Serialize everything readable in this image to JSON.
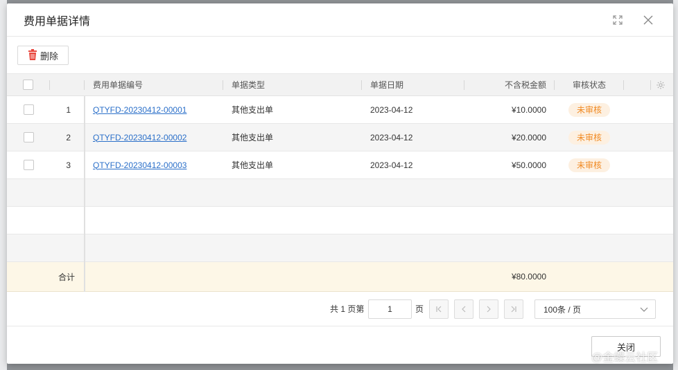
{
  "dialog": {
    "title": "费用单据详情",
    "icons": {
      "maximize": "expand-icon",
      "close": "close-icon"
    }
  },
  "toolbar": {
    "delete_label": "删除",
    "delete_icon": "trash-icon"
  },
  "table": {
    "headers": {
      "bill_no": "费用单据编号",
      "bill_type": "单据类型",
      "bill_date": "单据日期",
      "amount": "不含税金额",
      "status": "审核状态"
    },
    "rows": [
      {
        "index": "1",
        "bill_no": "QTYFD-20230412-00001",
        "bill_type": "其他支出单",
        "bill_date": "2023-04-12",
        "amount": "¥10.0000",
        "status": "未审核"
      },
      {
        "index": "2",
        "bill_no": "QTYFD-20230412-00002",
        "bill_type": "其他支出单",
        "bill_date": "2023-04-12",
        "amount": "¥20.0000",
        "status": "未审核"
      },
      {
        "index": "3",
        "bill_no": "QTYFD-20230412-00003",
        "bill_type": "其他支出单",
        "bill_date": "2023-04-12",
        "amount": "¥50.0000",
        "status": "未审核"
      }
    ],
    "summary": {
      "label": "合计",
      "amount": "¥80.0000"
    }
  },
  "pager": {
    "total_pages_text": "共 1 页第",
    "current_page": "1",
    "page_suffix": "页",
    "page_size": "100条 / 页"
  },
  "footer": {
    "close_label": "关闭"
  },
  "watermark": "@金蝶云社区",
  "colors": {
    "link": "#2a6fc9",
    "status_text": "#f08a24",
    "status_bg": "#fdf0e1",
    "summary_bg": "#fdf7e7",
    "delete_icon": "#e8453c"
  }
}
